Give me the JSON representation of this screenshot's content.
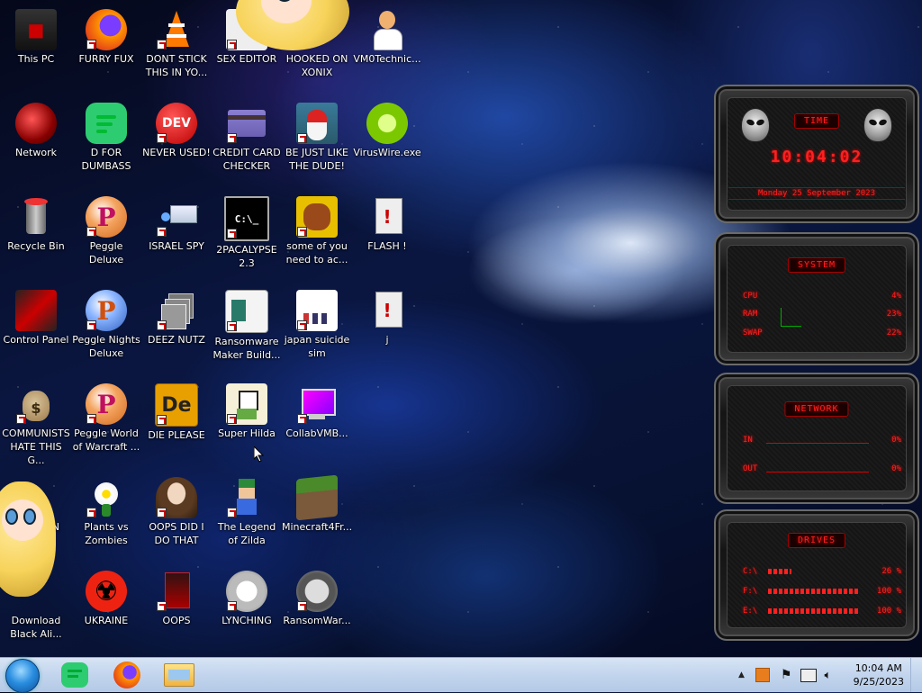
{
  "desktop": {
    "icons": [
      {
        "label": "This PC",
        "icon": "computer-icon"
      },
      {
        "label": "FURRY FUX",
        "icon": "firefox-icon"
      },
      {
        "label": "DONT STICK THIS IN YO...",
        "icon": "vlc-cone-icon"
      },
      {
        "label": "SEX EDITOR",
        "icon": "cartoon-girl-icon"
      },
      {
        "label": "HOOKED ON XONIX",
        "icon": "cartoon-girl-icon"
      },
      {
        "label": "VM0Technic...",
        "icon": "doctor-avatar-icon"
      },
      {
        "label": "Network",
        "icon": "network-globe-icon"
      },
      {
        "label": "D FOR DUMBASS",
        "icon": "chat-app-icon"
      },
      {
        "label": "NEVER USED!",
        "icon": "dev-cpp-icon"
      },
      {
        "label": "CREDIT CARD CHECKER",
        "icon": "credit-card-icon"
      },
      {
        "label": "BE JUST LIKE THE DUDE!",
        "icon": "santa-dude-icon"
      },
      {
        "label": "VirusWire.exe",
        "icon": "lime-icon"
      },
      {
        "label": "Recycle Bin",
        "icon": "recycle-bin-icon"
      },
      {
        "label": "Peggle Deluxe",
        "icon": "peggle-icon"
      },
      {
        "label": "ISRAEL SPY",
        "icon": "network-share-icon"
      },
      {
        "label": "2PACALYPSE 2.3",
        "icon": "terminal-icon"
      },
      {
        "label": "some of you need to ac...",
        "icon": "dog-icon"
      },
      {
        "label": "FLASH !",
        "icon": "flash-file-icon"
      },
      {
        "label": "Control Panel",
        "icon": "control-panel-icon"
      },
      {
        "label": "Peggle Nights Deluxe",
        "icon": "peggle-nights-icon"
      },
      {
        "label": "DEEZ NUTZ",
        "icon": "windows-stack-icon"
      },
      {
        "label": "Ransomware Maker Build...",
        "icon": "ransomware-maker-icon"
      },
      {
        "label": "japan suicide sim",
        "icon": "japan-sim-icon"
      },
      {
        "label": "j",
        "icon": "flash-file-icon"
      },
      {
        "label": "COMMUNISTS HATE THIS G...",
        "icon": "money-bag-icon"
      },
      {
        "label": "Peggle World of Warcraft ...",
        "icon": "peggle-icon"
      },
      {
        "label": "DIE PLEASE",
        "icon": "de-icon"
      },
      {
        "label": "Super Hilda",
        "icon": "pixel-character-icon"
      },
      {
        "label": "CollabVMB...",
        "icon": "collabvm-icon"
      },
      {
        "label": "N",
        "icon": "hidden-icon"
      },
      {
        "label": "Plants vs Zombies",
        "icon": "flower-icon"
      },
      {
        "label": "OOPS DID I DO THAT",
        "icon": "portrait-icon"
      },
      {
        "label": "The Legend of Zilda",
        "icon": "pixel-hero-icon"
      },
      {
        "label": "Minecraft4Fr...",
        "icon": "minecraft-block-icon"
      },
      {
        "label": "Download Black Ali...",
        "icon": "download-icon"
      },
      {
        "label": "UKRAINE",
        "icon": "radiation-icon"
      },
      {
        "label": "OOPS",
        "icon": "red-file-icon"
      },
      {
        "label": "LYNCHING",
        "icon": "emblem-icon"
      },
      {
        "label": "RansomWar...",
        "icon": "skull-icon"
      }
    ]
  },
  "gadget": {
    "time": {
      "title": "TIME",
      "clock": "10:04:02",
      "date": "Monday 25 September 2023"
    },
    "system": {
      "title": "SYSTEM",
      "rows": [
        {
          "label": "CPU",
          "value": "4%"
        },
        {
          "label": "RAM",
          "value": "23%"
        },
        {
          "label": "SWAP",
          "value": "22%"
        }
      ]
    },
    "network": {
      "title": "NETWORK",
      "rows": [
        {
          "label": "IN",
          "value": "0%"
        },
        {
          "label": "OUT",
          "value": "0%"
        }
      ]
    },
    "drives": {
      "title": "DRIVES",
      "rows": [
        {
          "label": "C:\\",
          "value": "26 %",
          "fill": 0.26
        },
        {
          "label": "F:\\",
          "value": "100 %",
          "fill": 1.0
        },
        {
          "label": "E:\\",
          "value": "100 %",
          "fill": 1.0
        }
      ]
    }
  },
  "taskbar": {
    "pinned": [
      "chat-app-icon",
      "firefox-icon",
      "file-explorer-icon"
    ],
    "clock_time": "10:04 AM",
    "clock_date": "9/25/2023",
    "tray_icons": [
      "show-hidden-icons-chevron",
      "app-tray-icon",
      "flag-icon",
      "network-icon",
      "volume-icon"
    ]
  },
  "colors": {
    "gadget_red": "#ff2020",
    "taskbar": "#c4d6ee"
  }
}
